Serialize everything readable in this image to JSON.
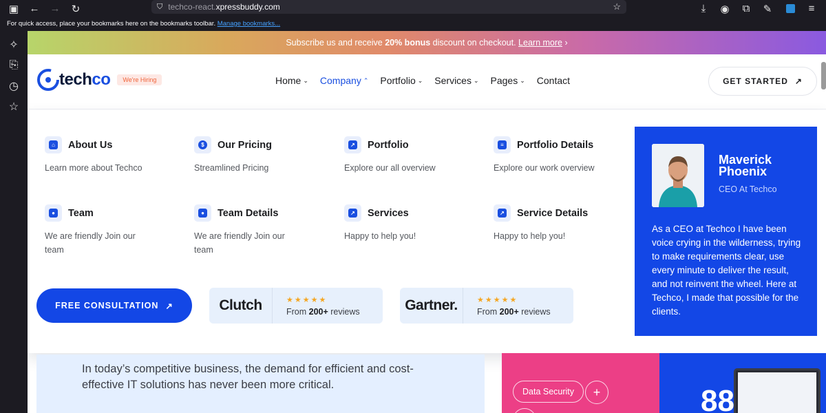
{
  "browser": {
    "url_prefix": "techco-react.",
    "url_domain": "xpressbuddy.com",
    "bookmarks_text": "For quick access, place your bookmarks here on the bookmarks toolbar.",
    "bookmarks_link": "Manage bookmarks..."
  },
  "promo": {
    "text_before": "Subscribe us and receive ",
    "bold": "20% bonus",
    "text_after": " discount on checkout. ",
    "link": "Learn more",
    "arrow": "›"
  },
  "header": {
    "logo_main": "tech",
    "logo_accent": "co",
    "hiring_badge": "We're Hiring",
    "nav": [
      {
        "label": "Home",
        "chevron": "⌄"
      },
      {
        "label": "Company",
        "chevron": "⌃"
      },
      {
        "label": "Portfolio",
        "chevron": "⌄"
      },
      {
        "label": "Services",
        "chevron": "⌄"
      },
      {
        "label": "Pages",
        "chevron": "⌄"
      },
      {
        "label": "Contact"
      }
    ],
    "cta_label": "GET STARTED",
    "cta_arrow": "↗"
  },
  "mega": {
    "items": [
      {
        "title": "About Us",
        "desc": "Learn more about Techco",
        "icon": "home-icon"
      },
      {
        "title": "Our Pricing",
        "desc": "Streamlined Pricing",
        "icon": "dollar-icon"
      },
      {
        "title": "Portfolio",
        "desc": "Explore our all overview",
        "icon": "chart-icon"
      },
      {
        "title": "Portfolio Details",
        "desc": "Explore our work overview",
        "icon": "document-icon"
      },
      {
        "title": "Team",
        "desc": "We are friendly Join our team",
        "icon": "team-icon"
      },
      {
        "title": "Team Details",
        "desc": "We are friendly Join our team",
        "icon": "users-icon"
      },
      {
        "title": "Services",
        "desc": "Happy to help you!",
        "icon": "service-icon"
      },
      {
        "title": "Service Details",
        "desc": "Happy to help you!",
        "icon": "service-icon"
      }
    ],
    "consult_label": "FREE CONSULTATION",
    "consult_arrow": "↗",
    "reviews": [
      {
        "brand": "Clutch",
        "stars": "★★★★★",
        "prefix": "From ",
        "count": "200+",
        "suffix": " reviews"
      },
      {
        "brand": "Gartner.",
        "stars": "★★★★★",
        "prefix": "From ",
        "count": "200+",
        "suffix": " reviews"
      }
    ],
    "ceo": {
      "name": "Maverick Phoenix",
      "role": "CEO At Techco",
      "quote": "As a CEO at Techco I have been voice crying in the wilderness, trying to make requirements clear, use every minute to deliver the result, and not reinvent the wheel. Here at Techco, I made that possible for the clients."
    }
  },
  "below": {
    "intro": "In today’s competitive business, the demand for efficient and cost-effective IT solutions has never been more critical.",
    "pill_1": "Data Security",
    "plus": "+",
    "big_number": "88"
  },
  "colors": {
    "brand_blue": "#1347e6",
    "pink": "#ec3f86",
    "hiring_bg": "#fde8e4",
    "hiring_text": "#f0643a",
    "star": "#f5a623"
  }
}
